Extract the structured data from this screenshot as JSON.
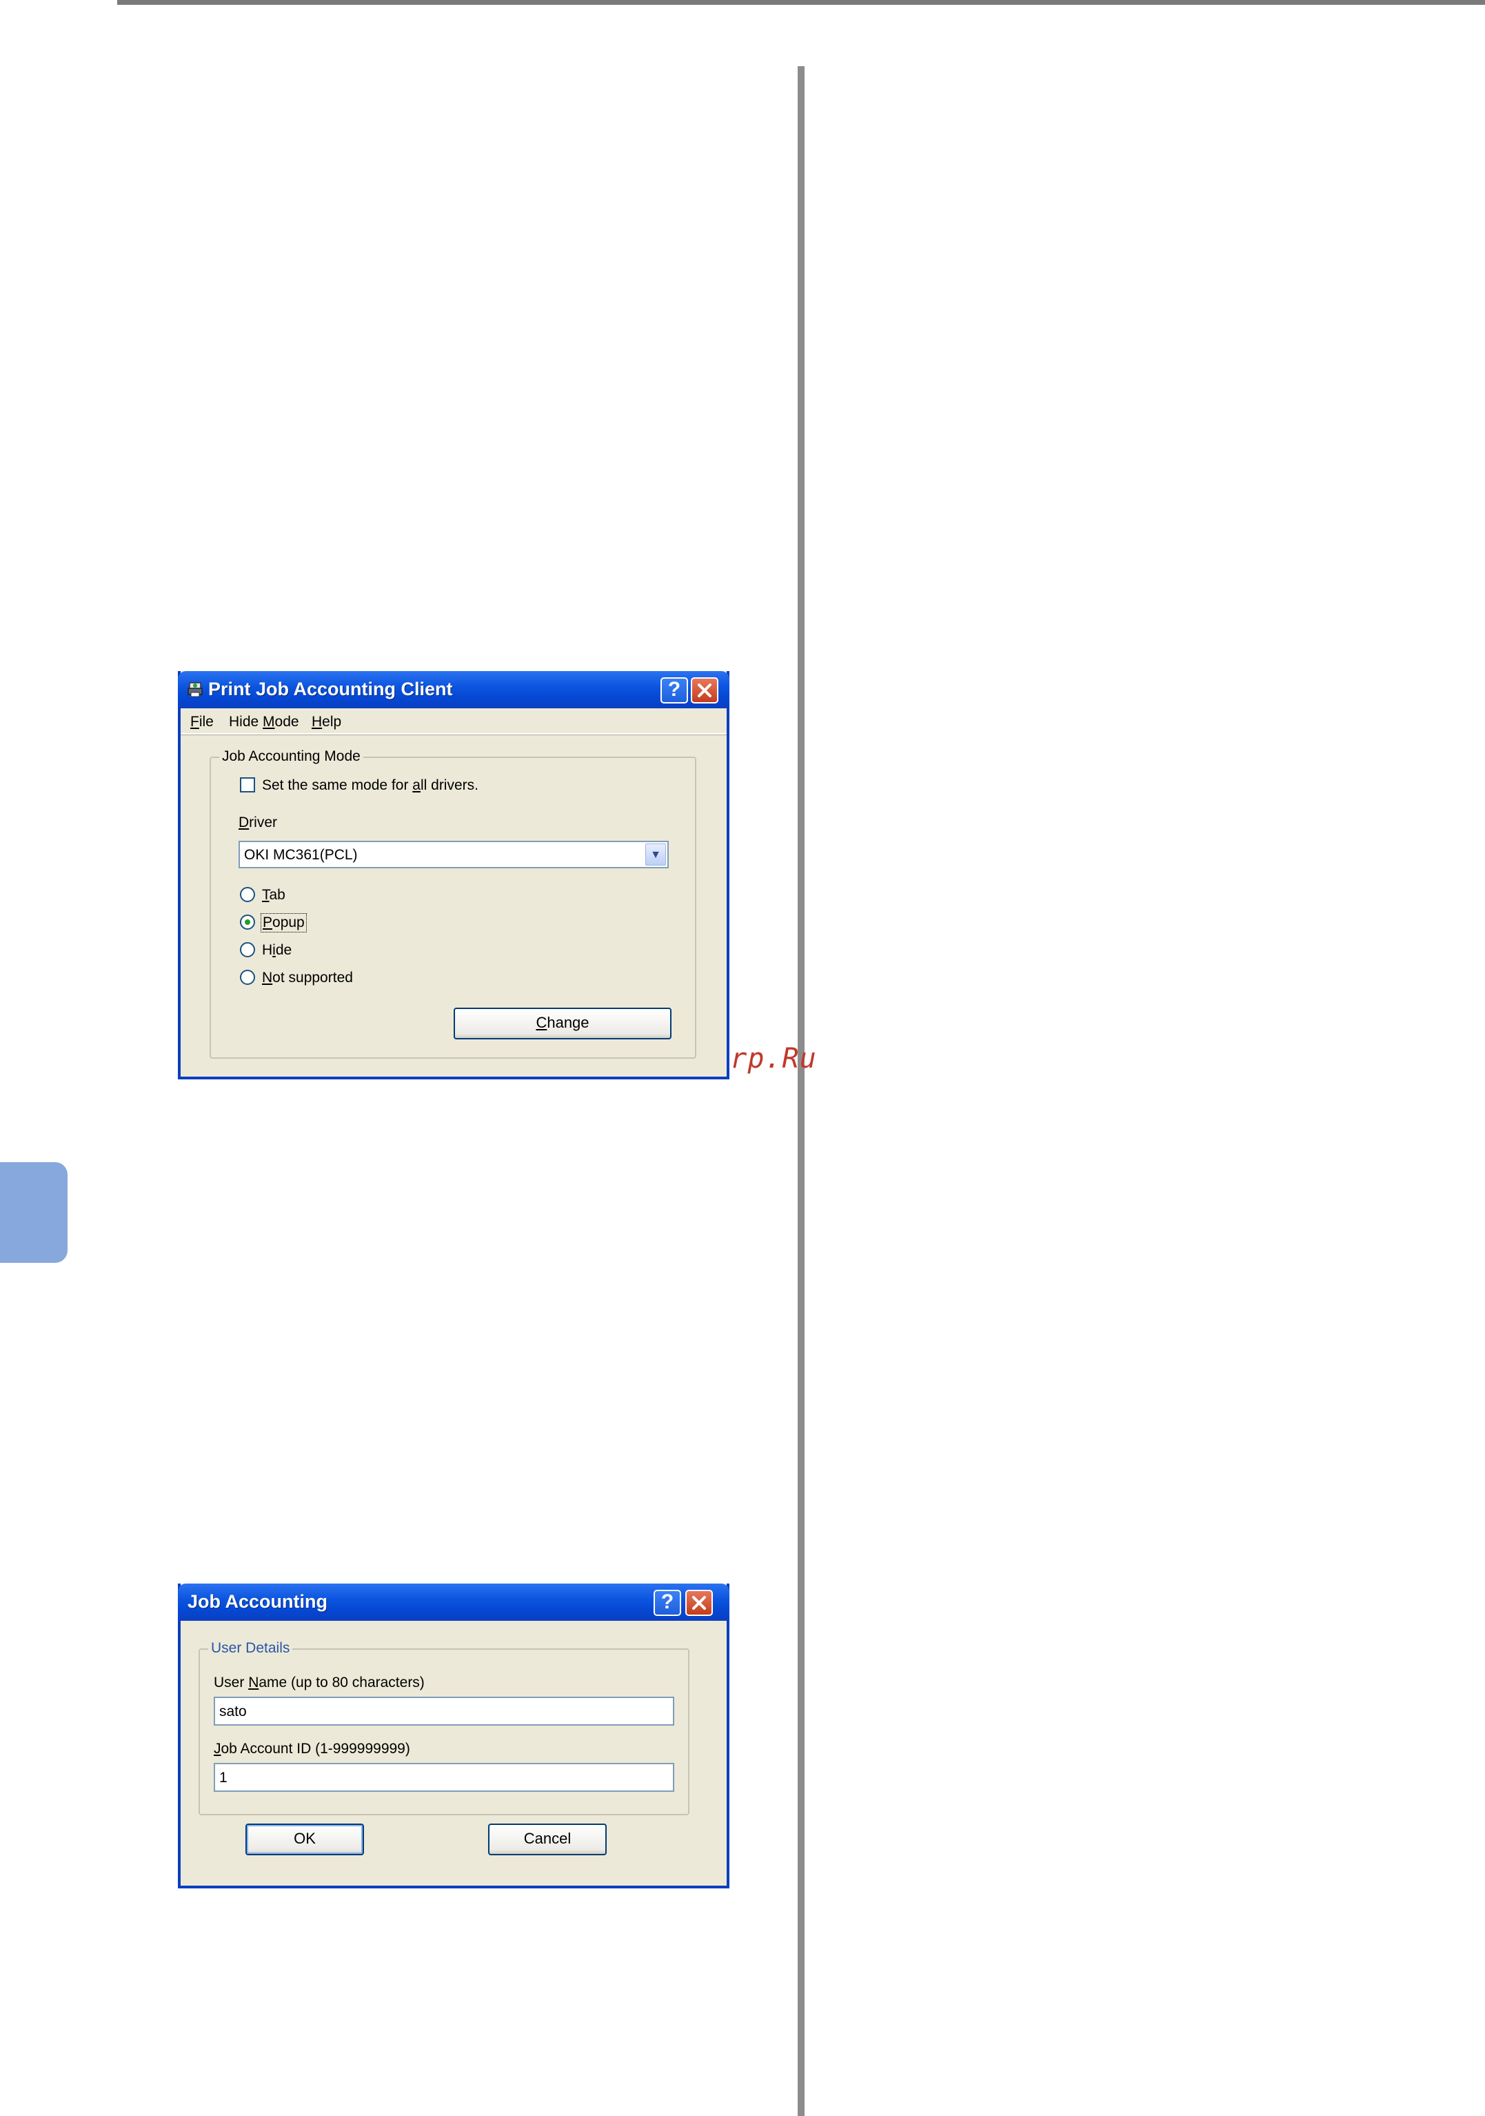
{
  "colors": {
    "xp_title_blue": "#0a3fc1",
    "xp_face": "#ece9d8",
    "side_tab": "#86a8dd",
    "watermark": "#c0392b",
    "divider": "#8c8c8c"
  },
  "watermark": "McGrp.Ru",
  "client_window": {
    "title": "Print Job Accounting Client",
    "icon": "printer-app-icon",
    "menu": {
      "file": "File",
      "hide_mode": "Hide Mode",
      "help": "Help"
    },
    "group_label": "Job Accounting Mode",
    "same_mode_checkbox": {
      "label": "Set the same mode for all drivers.",
      "checked": false
    },
    "driver_label": "Driver",
    "driver_value": "OKI MC361(PCL)",
    "modes": [
      {
        "label": "Tab",
        "selected": false
      },
      {
        "label": "Popup",
        "selected": true
      },
      {
        "label": "Hide",
        "selected": false
      },
      {
        "label": "Not supported",
        "selected": false
      }
    ],
    "change_button": "Change"
  },
  "job_window": {
    "title": "Job Accounting",
    "group_label": "User Details",
    "user_name_label": "User Name (up to 80 characters)",
    "user_name_value": "sato",
    "account_id_label": "Job Account ID (1-999999999)",
    "account_id_value": "1",
    "ok_button": "OK",
    "cancel_button": "Cancel"
  }
}
